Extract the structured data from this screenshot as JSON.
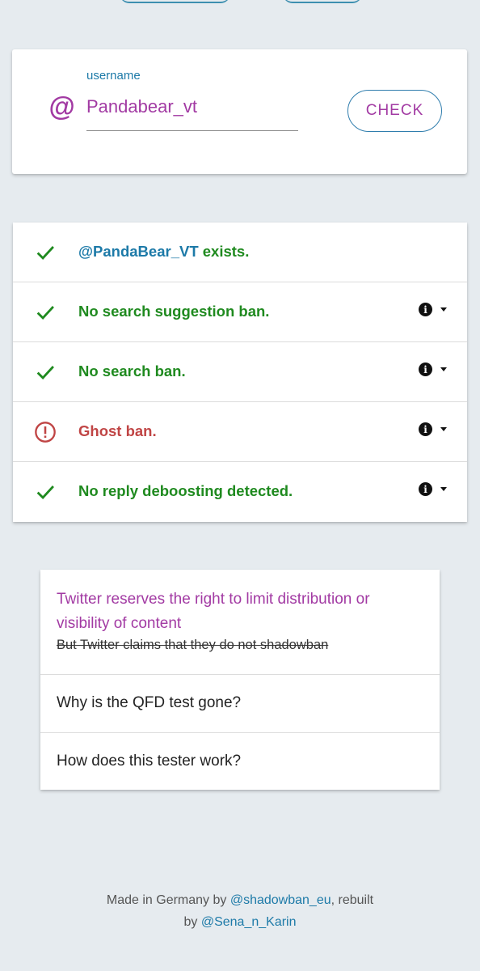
{
  "search": {
    "label": "username",
    "value": "Pandabear_vt",
    "at_symbol": "@",
    "check_button": "CHECK"
  },
  "results": [
    {
      "status": "ok",
      "handle": "@PandaBear_VT",
      "text": " exists.",
      "has_info": false
    },
    {
      "status": "ok",
      "text": "No search suggestion ban.",
      "has_info": true
    },
    {
      "status": "ok",
      "text": "No search ban.",
      "has_info": true
    },
    {
      "status": "warn",
      "text": "Ghost ban.",
      "has_info": true
    },
    {
      "status": "ok",
      "text": "No reply deboosting detected.",
      "has_info": true
    }
  ],
  "faq": {
    "item1_title": "Twitter reserves the right to limit distribution or visibility of content",
    "item1_strike": "But Twitter claims that they do not shadowban",
    "item2": "Why is the QFD test gone?",
    "item3": "How does this tester work?"
  },
  "footer": {
    "text1": "Made in Germany by ",
    "link1": "@shadowban_eu",
    "text2": ", rebuilt",
    "text3": "by ",
    "link2": "@Sena_n_Karin"
  },
  "colors": {
    "accent_purple": "#a23aa3",
    "link_blue": "#1d7aa8",
    "ok_green": "#1f8a1f",
    "warn_red": "#c04545",
    "background": "#e6ebef"
  },
  "icons": {
    "ok": "check-icon",
    "warn": "alert-circle-icon",
    "info": "info-icon",
    "expand": "caret-down-icon"
  }
}
